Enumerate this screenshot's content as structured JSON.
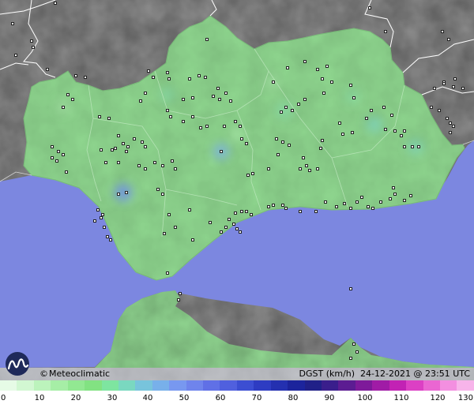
{
  "credit": {
    "copyright": "©",
    "brand": "Meteoclimatic"
  },
  "info": {
    "parameter": "DGST",
    "unit": "(km/h)",
    "date": "24-12-2021",
    "at": "@",
    "time": "23:51",
    "tz": "UTC"
  },
  "legend": {
    "ticks": [
      "0",
      "10",
      "20",
      "30",
      "40",
      "50",
      "60",
      "70",
      "80",
      "90",
      "100",
      "110",
      "120",
      "130"
    ],
    "colors": [
      "#e6fbe6",
      "#d2f7d2",
      "#bcf3bc",
      "#a6eea6",
      "#92e892",
      "#82e282",
      "#7ee5a0",
      "#7ad8c0",
      "#78c4dc",
      "#78b0ea",
      "#7898f0",
      "#6f84ec",
      "#6070e6",
      "#5060de",
      "#3c4ed2",
      "#2e3cc2",
      "#2430b0",
      "#1c249c",
      "#202088",
      "#3a1e8c",
      "#5c1c92",
      "#7e1a9a",
      "#a01ca6",
      "#c222b4",
      "#dc40c4",
      "#ea66d2",
      "#f38fe0",
      "#f7b4ea"
    ]
  },
  "colors": {
    "sea": "#7c87e0",
    "land": "#90d890",
    "foreign": "#9a9a9a",
    "background": "#8a8a8a"
  },
  "stations": {
    "count": 180,
    "symbol": "station-icon"
  }
}
